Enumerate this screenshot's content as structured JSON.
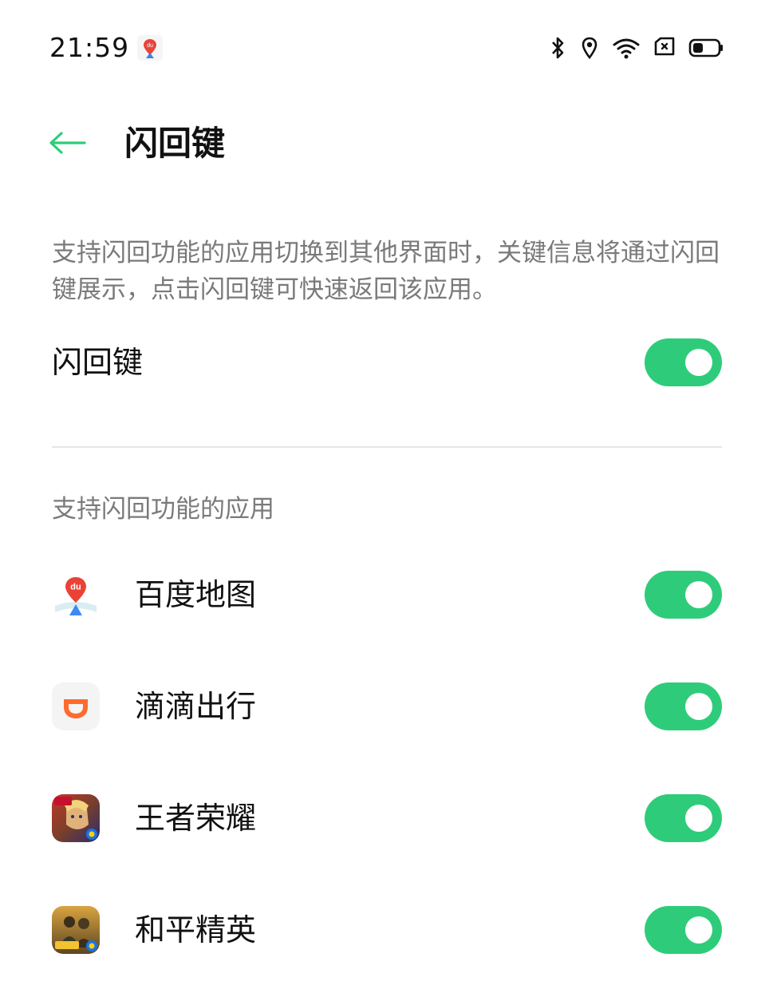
{
  "status_bar": {
    "time": "21:59",
    "icons": [
      "baidu-maps-notification-icon",
      "bluetooth-icon",
      "location-icon",
      "wifi-icon",
      "sim-card-icon",
      "battery-icon"
    ]
  },
  "header": {
    "title": "闪回键",
    "back_icon": "arrow-left-icon"
  },
  "description": "支持闪回功能的应用切换到其他界面时，关键信息将通过闪回键展示，点击闪回键可快速返回该应用。",
  "main_toggle": {
    "label": "闪回键",
    "on": true
  },
  "section": {
    "title": "支持闪回功能的应用",
    "apps": [
      {
        "name": "百度地图",
        "icon": "baidu-maps-icon",
        "on": true
      },
      {
        "name": "滴滴出行",
        "icon": "didi-icon",
        "on": true
      },
      {
        "name": "王者荣耀",
        "icon": "honor-of-kings-icon",
        "on": true
      },
      {
        "name": "和平精英",
        "icon": "peacekeeper-elite-icon",
        "on": true
      }
    ]
  },
  "colors": {
    "accent": "#2ECC7A",
    "text_primary": "#111111",
    "text_secondary": "#7A7A7A",
    "divider": "#E6E6E6"
  }
}
